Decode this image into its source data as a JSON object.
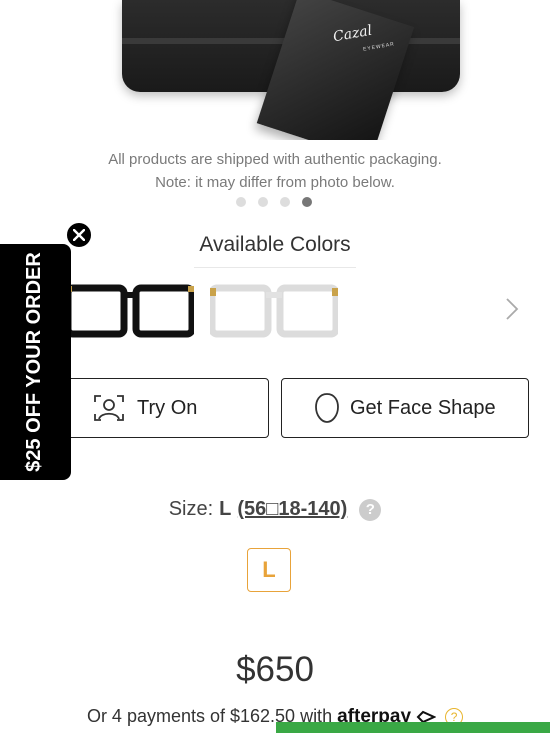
{
  "product_image": {
    "brand_text": "Cazal",
    "brand_subtext": "EYEWEAR"
  },
  "notice": {
    "line1": "All products are shipped with authentic packaging.",
    "line2": "Note: it may differ from photo below."
  },
  "carousel": {
    "total_slides": 4,
    "active_slide": 4
  },
  "available_colors": {
    "title": "Available Colors",
    "swatches": [
      "black-gold frame",
      "crystal-gold frame"
    ]
  },
  "buttons": {
    "try_on": "Try On",
    "face_shape": "Get Face Shape"
  },
  "promo": {
    "text": "$25 OFF YOUR ORDER"
  },
  "size": {
    "label": "Size:",
    "value": "L",
    "dims": "(56□18-140)",
    "help": "?",
    "option": "L"
  },
  "price": "$650",
  "afterpay": {
    "text": "Or 4 payments of $162.50 with",
    "logo": "afterpay",
    "help": "?"
  },
  "colors": {
    "accent": "#e8a33a",
    "promo_bg": "#000000",
    "cta_green": "#3aa845"
  }
}
